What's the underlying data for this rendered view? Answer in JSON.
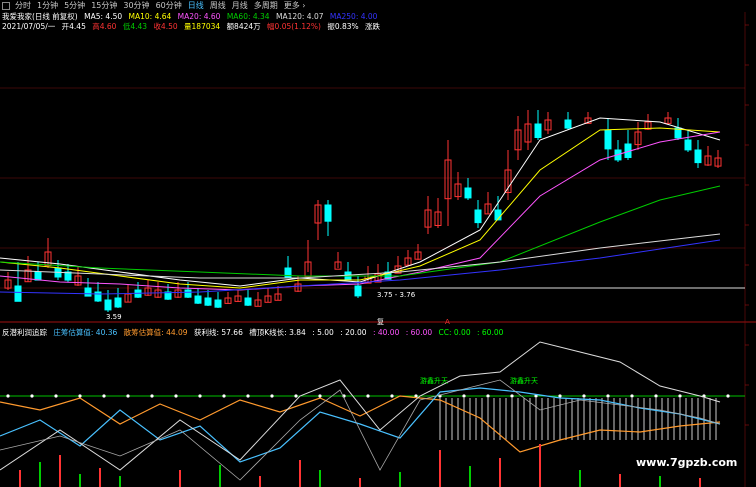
{
  "tabs": [
    {
      "label": "分时",
      "active": false
    },
    {
      "label": "1分钟",
      "active": false
    },
    {
      "label": "5分钟",
      "active": false
    },
    {
      "label": "15分钟",
      "active": false
    },
    {
      "label": "30分钟",
      "active": false
    },
    {
      "label": "60分钟",
      "active": false
    },
    {
      "label": "日线",
      "active": true
    },
    {
      "label": "周线",
      "active": false
    },
    {
      "label": "月线",
      "active": false
    },
    {
      "label": "多周期",
      "active": false
    },
    {
      "label": "更多 ›",
      "active": false
    }
  ],
  "stock": {
    "name": "我爱我家(日线 前复权)",
    "ma5": "MA5: 4.50",
    "ma10": "MA10: 4.64",
    "ma20": "MA20: 4.60",
    "ma60": "MA60: 4.34",
    "ma120": "MA120: 4.07",
    "ma250": "MA250: 4.00"
  },
  "quote": {
    "date": "2021/07/05/一",
    "open": "开4.45",
    "high": "高4.60",
    "low": "低4.43",
    "close": "收4.50",
    "volume": "量187034",
    "amount": "额8424万",
    "change": "幅0.05(1.12%)",
    "swing": "振0.83%",
    "extra": "涨跌"
  },
  "annotations": {
    "low_price": "3.59",
    "range_price": "3.75 - 3.76",
    "marker_mid": "复",
    "marker_red": "A"
  },
  "indicator": {
    "title": "反潜利润追踪",
    "items": [
      {
        "text": "庄筹估算值: 40.36",
        "color": "#49c1ff"
      },
      {
        "text": "散筹估算值: 44.09",
        "color": "#ff9a2e"
      },
      {
        "text": "获利线: 57.66",
        "color": "#ffffff"
      },
      {
        "text": "槽顶K线长: 3.84",
        "color": "#ffffff"
      },
      {
        "text": ": 5.00",
        "color": "#ffffff"
      },
      {
        "text": ": 20.00",
        "color": "#ffffff"
      },
      {
        "text": ": 40.00",
        "color": "#ff55ff"
      },
      {
        "text": ": 60.00",
        "color": "#ff55ff"
      },
      {
        "text": "CC: 0.00",
        "color": "#00ff00"
      },
      {
        "text": ": 60.00",
        "color": "#00ff00"
      }
    ],
    "signal1": "游鑫升天",
    "signal2": "游鑫升天"
  },
  "watermark": "www.7gpzb.com",
  "colors": {
    "up": "#ff3333",
    "down": "#00ffff",
    "ma5": "#ffffff",
    "ma10": "#ffff00",
    "ma20": "#ff55ff",
    "ma60": "#00cc00",
    "ma120": "#dddddd",
    "ma250": "#3333ff"
  }
}
